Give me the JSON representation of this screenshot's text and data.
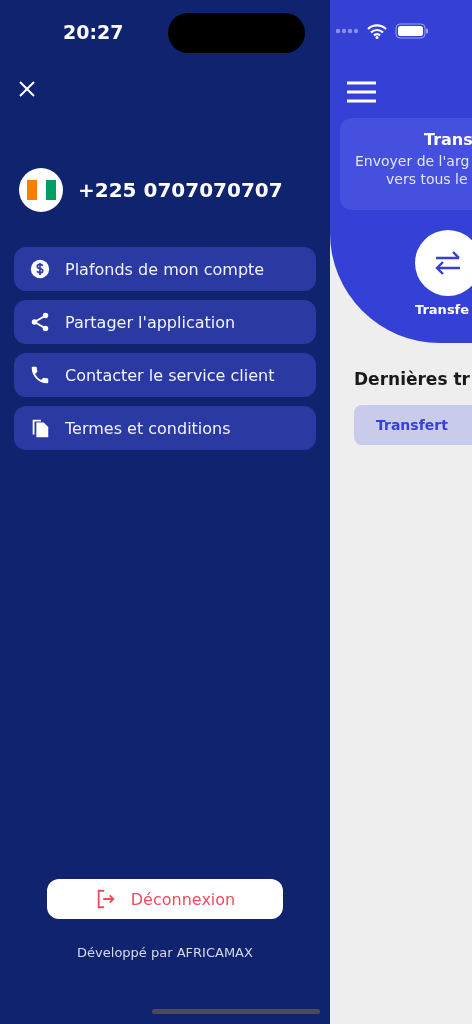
{
  "status_bar": {
    "time": "20:27"
  },
  "drawer": {
    "phone": "+225 0707070707",
    "menu": [
      {
        "kind": "dollar",
        "label": "Plafonds de mon compte"
      },
      {
        "kind": "share",
        "label": "Partager l'application"
      },
      {
        "kind": "phone",
        "label": "Contacter le service client"
      },
      {
        "kind": "document",
        "label": "Termes et conditions"
      }
    ],
    "logout": "Déconnexion",
    "footer": "Développé par AFRICAMAX"
  },
  "main": {
    "card": {
      "title": "Trans",
      "lines": [
        "Envoyer de l'arg",
        "vers tous le"
      ]
    },
    "action": {
      "label": "Transfe"
    },
    "section_title": "Dernières tr",
    "filters": [
      {
        "label": "Transfert",
        "selected": true
      }
    ]
  }
}
